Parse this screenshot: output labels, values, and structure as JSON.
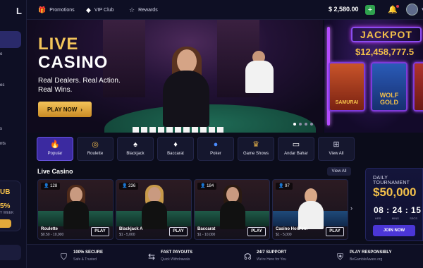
{
  "sidebar": {
    "logo": "L",
    "frag1": "o",
    "frag2": "es",
    "frag3": "s",
    "frag4": "nts",
    "promo_big": "UB",
    "promo_pct": "5%",
    "promo_week": "Y WEEK"
  },
  "topbar": {
    "promotions": "Promotions",
    "vip": "VIP Club",
    "rewards": "Rewards",
    "balance": "$ 2,580.00",
    "deposit": "+"
  },
  "hero": {
    "title_line1": "LIVE",
    "title_line2": "CASINO",
    "sub_line1": "Real Dealers. Real Action.",
    "sub_line2": "Real Wins.",
    "play_label": "PLAY NOW",
    "play_arrow": "›"
  },
  "jackpot": {
    "title": "JACKPOT",
    "amount": "$12,458,777.5",
    "slots": [
      {
        "label": "SAMURAI"
      },
      {
        "label": "WOLF GOLD"
      },
      {
        "label": ""
      }
    ]
  },
  "categories": [
    {
      "icon": "🔥",
      "label": "Popular",
      "active": true
    },
    {
      "icon": "◎",
      "label": "Roulette"
    },
    {
      "icon": "♠",
      "label": "Blackjack"
    },
    {
      "icon": "♦",
      "label": "Baccarat"
    },
    {
      "icon": "●",
      "label": "Poker"
    },
    {
      "icon": "♛",
      "label": "Game Shows"
    },
    {
      "icon": "▭",
      "label": "Andar Bahar"
    },
    {
      "icon": "⊞",
      "label": "View All"
    }
  ],
  "live_casino": {
    "title": "Live Casino",
    "view_all": "View All",
    "games": [
      {
        "players": "128",
        "name": "Roulette",
        "limits": "$0.50 - 10,000",
        "play": "PLAY"
      },
      {
        "players": "236",
        "name": "Blackjack A",
        "limits": "$1 - 5,000",
        "play": "PLAY"
      },
      {
        "players": "184",
        "name": "Baccarat",
        "limits": "$1 - 10,000",
        "play": "PLAY"
      },
      {
        "players": "97",
        "name": "Casino Hold'em",
        "limits": "$1 - 5,000",
        "play": "PLAY"
      }
    ],
    "next_arrow": "›"
  },
  "tournament": {
    "title": "DAILY TOURNAMENT",
    "amount": "$50,000",
    "countdown": "08 : 24 : 15",
    "hrs": "HRS",
    "mins": "MINS",
    "secs": "SECS",
    "join": "JOIN NOW"
  },
  "footer": [
    {
      "icon": "shield-check-icon",
      "title": "100% SECURE",
      "sub": "Safe & Trusted"
    },
    {
      "icon": "fast-payout-icon",
      "title": "FAST PAYOUTS",
      "sub": "Quick Withdrawals"
    },
    {
      "icon": "headset-icon",
      "title": "24/7 SUPPORT",
      "sub": "We're Here for You"
    },
    {
      "icon": "shield-play-icon",
      "title": "PLAY RESPONSIBLY",
      "sub": "BeGambleAware.org"
    }
  ],
  "colors": {
    "accent_gold": "#f3c04a",
    "brand_purple": "#3b2aa0",
    "deposit_green": "#2fa24e"
  }
}
